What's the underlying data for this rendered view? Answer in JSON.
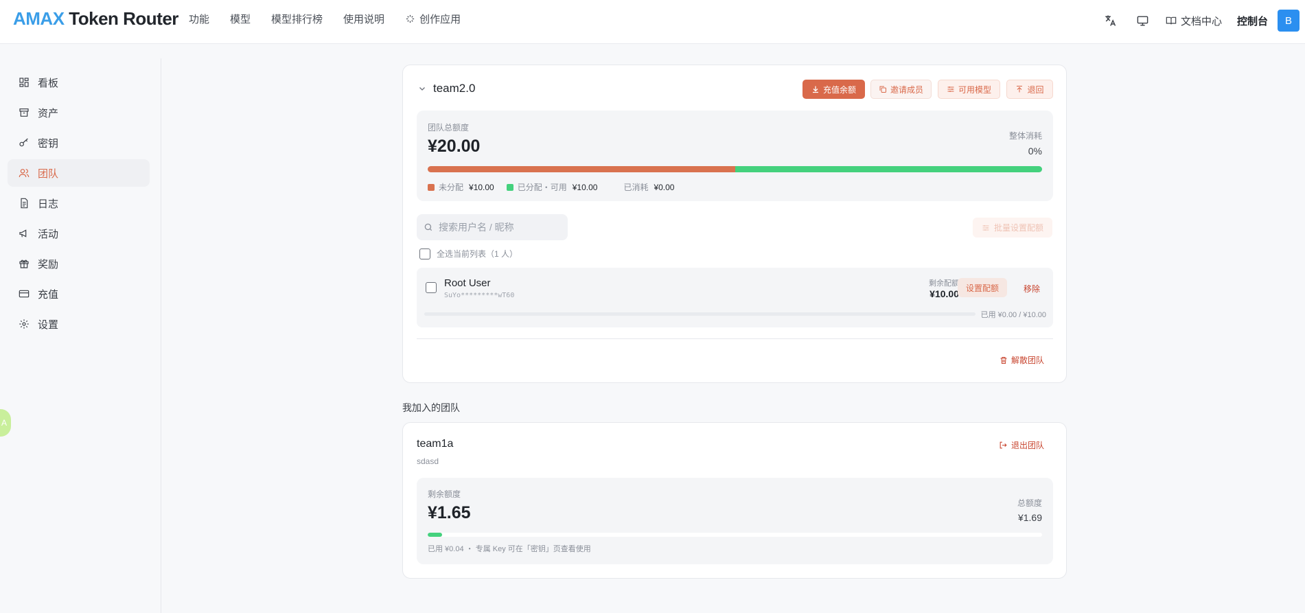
{
  "header": {
    "logo_a": "AMAX",
    "logo_b": " Token Router",
    "nav": [
      "功能",
      "模型",
      "模型排行榜",
      "使用说明",
      "创作应用"
    ],
    "docs": "文档中心",
    "console": "控制台",
    "avatar": "B"
  },
  "sidebar": {
    "items": [
      {
        "label": "看板",
        "icon": "dashboard-icon"
      },
      {
        "label": "资产",
        "icon": "archive-icon"
      },
      {
        "label": "密钥",
        "icon": "key-icon"
      },
      {
        "label": "团队",
        "icon": "users-icon",
        "active": true
      },
      {
        "label": "日志",
        "icon": "document-icon"
      },
      {
        "label": "活动",
        "icon": "megaphone-icon"
      },
      {
        "label": "奖励",
        "icon": "gift-icon"
      },
      {
        "label": "充值",
        "icon": "credit-card-icon"
      },
      {
        "label": "设置",
        "icon": "gear-icon"
      }
    ],
    "float_badge": "A"
  },
  "team": {
    "name": "team2.0",
    "buttons": {
      "recharge": "充值余额",
      "invite": "邀请成员",
      "models": "可用模型",
      "back": "退回"
    },
    "quota": {
      "label": "团队总额度",
      "amount": "¥20.00",
      "consume_label": "整体消耗",
      "consume_value": "0%",
      "bar": {
        "unallocated_fraction": 0.5,
        "allocated_fraction": 0.5
      },
      "legend": {
        "unallocated_label": "未分配",
        "unallocated_value": "¥10.00",
        "allocated_label": "已分配・可用",
        "allocated_value": "¥10.00",
        "consumed_label": "已消耗",
        "consumed_value": "¥0.00"
      },
      "colors": {
        "unallocated": "#d9724f",
        "allocated": "#44d17d"
      }
    },
    "search_placeholder": "搜索用户名 / 昵称",
    "batch_button": "批量设置配额",
    "select_all": "全选当前列表（1 人）",
    "members": [
      {
        "name": "Root User",
        "key": "SuYo*********wT60",
        "remaining_label": "剩余配额",
        "remaining_value": "¥10.00",
        "set_button": "设置配额",
        "remove": "移除",
        "used": "已用 ¥0.00 / ¥10.00",
        "used_fraction": 0
      }
    ],
    "dissolve": "解散团队"
  },
  "joined": {
    "section_title": "我加入的团队",
    "team": {
      "name": "team1a",
      "desc": "sdasd",
      "leave": "退出团队",
      "remaining_label": "剩余额度",
      "remaining_value": "¥1.65",
      "total_label": "总额度",
      "total_value": "¥1.69",
      "used_fraction": 0.024,
      "note": "已用 ¥0.04 ・ 专属 Key 可在「密钥」页查看使用"
    }
  },
  "colors": {
    "accent": "#d9694a",
    "brand_blue": "#3b9ee8"
  }
}
